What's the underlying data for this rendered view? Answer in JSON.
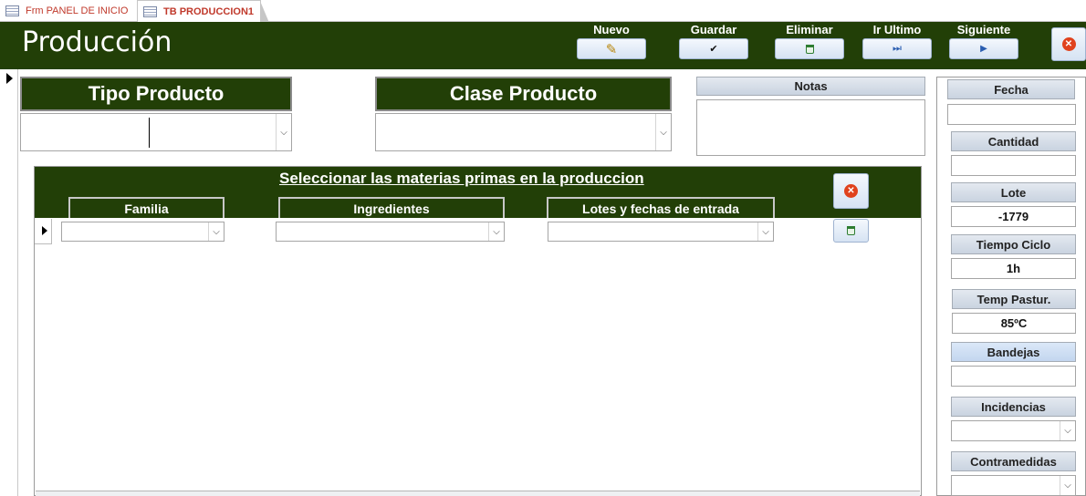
{
  "tabs": [
    {
      "label": "Frm PANEL DE INICIO"
    },
    {
      "label": "TB PRODUCCION1"
    }
  ],
  "header": {
    "title": "Producción",
    "buttons": [
      {
        "label": "Nuevo",
        "icon": "pencil-icon",
        "glyph": "✎"
      },
      {
        "label": "Guardar",
        "icon": "check-icon",
        "glyph": "✔"
      },
      {
        "label": "Eliminar",
        "icon": "trash-icon",
        "glyph": ""
      },
      {
        "label": "Ir Ultimo",
        "icon": "skip-last-icon",
        "glyph": "⏭"
      },
      {
        "label": "Siguiente",
        "icon": "play-next-icon",
        "glyph": "▶"
      }
    ],
    "close_glyph": "✕"
  },
  "form": {
    "tipo_producto_label": "Tipo Producto",
    "tipo_producto_value": "",
    "clase_producto_label": "Clase Producto",
    "clase_producto_value": "",
    "notas_label": "Notas",
    "notas_value": ""
  },
  "subform": {
    "title": "Seleccionar las materias primas en la produccion",
    "columns": [
      "Familia",
      "Ingredientes",
      "Lotes y fechas de entrada"
    ],
    "row": {
      "familia": "",
      "ingredientes": "",
      "lotes": ""
    }
  },
  "side": {
    "fecha_label": "Fecha",
    "fecha_value": "",
    "cantidad_label": "Cantidad",
    "cantidad_value": "",
    "lote_label": "Lote",
    "lote_value": "-1779",
    "tiempo_label": "Tiempo Ciclo",
    "tiempo_value": "1h",
    "temp_label": "Temp Pastur.",
    "temp_value": "85ºC",
    "bandejas_label": "Bandejas",
    "bandejas_value": "",
    "incidencias_label": "Incidencias",
    "incidencias_value": "",
    "contramedidas_label": "Contramedidas",
    "contramedidas_value": ""
  },
  "colors": {
    "header_bg": "#223f07",
    "accent_red": "#e0421d",
    "tab_text": "#c0392b"
  }
}
